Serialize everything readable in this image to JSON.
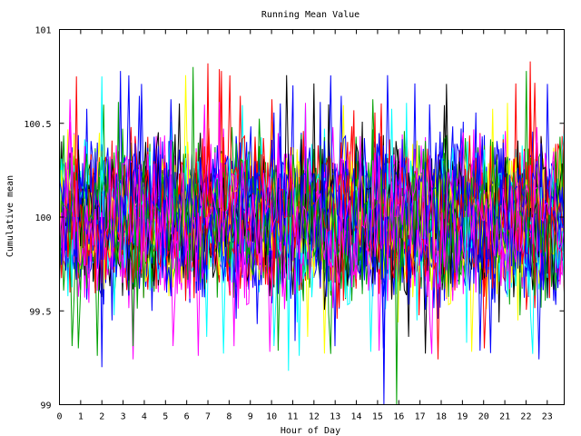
{
  "chart_data": {
    "type": "line",
    "title": "Running Mean Value",
    "xlabel": "Hour of Day",
    "ylabel": "Cumulative mean",
    "xlim": [
      0,
      23.8
    ],
    "ylim": [
      99,
      101
    ],
    "x_ticks": [
      0,
      1,
      2,
      3,
      4,
      5,
      6,
      7,
      8,
      9,
      10,
      11,
      12,
      13,
      14,
      15,
      16,
      17,
      18,
      19,
      20,
      21,
      22,
      23
    ],
    "x_tick_labels": [
      "0",
      "1",
      "2",
      "3",
      "4",
      "5",
      "6",
      "7",
      "8",
      "9",
      "10",
      "11",
      "12",
      "13",
      "14",
      "15",
      "16",
      "17",
      "18",
      "19",
      "20",
      "21",
      "22",
      "23"
    ],
    "y_ticks": [
      99,
      99.5,
      100,
      100.5,
      101
    ],
    "y_tick_labels": [
      "99",
      "99.5",
      "100",
      "100.5",
      "101"
    ],
    "grid": false,
    "legend": "none",
    "series_count": 36,
    "value_range": {
      "typical_min": 99.6,
      "typical_max": 100.4,
      "center": 100.0
    },
    "series_colors": [
      "#0000ff",
      "#ff0000",
      "#00a000",
      "#ff00ff",
      "#00ffff",
      "#ffff00",
      "#000000",
      "#0000ff",
      "#ff0000",
      "#0000ff",
      "#00a000",
      "#ff00ff"
    ],
    "notable_points": [
      {
        "x": 0.8,
        "y": 100.75
      },
      {
        "x": 2.0,
        "y": 100.75
      },
      {
        "x": 2.0,
        "y": 99.2
      },
      {
        "x": 6.3,
        "y": 100.8
      },
      {
        "x": 7.0,
        "y": 100.82
      },
      {
        "x": 10.8,
        "y": 99.18
      },
      {
        "x": 15.3,
        "y": 99.0
      },
      {
        "x": 15.9,
        "y": 99.0
      },
      {
        "x": 22.2,
        "y": 100.83
      },
      {
        "x": 19.2,
        "y": 99.33
      }
    ]
  }
}
